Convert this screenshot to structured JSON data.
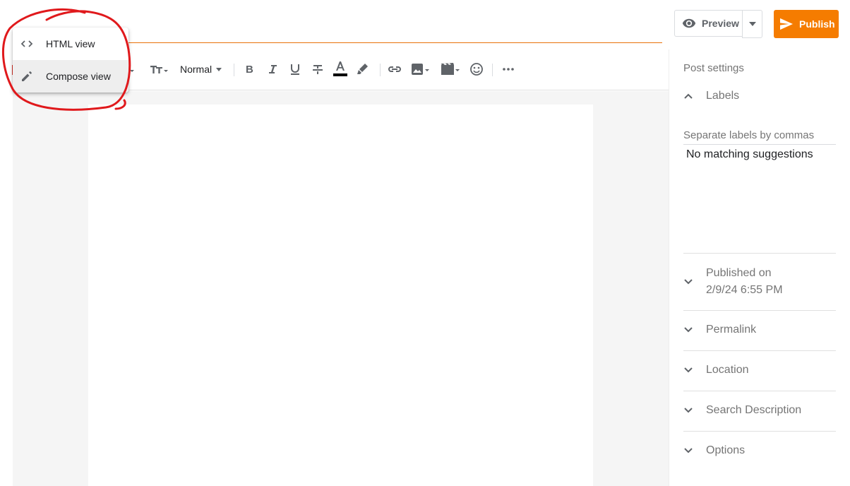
{
  "header": {
    "preview_label": "Preview",
    "publish_label": "Publish"
  },
  "toolbar": {
    "paragraph_style": "Normal",
    "text_color": "#000000"
  },
  "view_menu": {
    "items": [
      {
        "label": "HTML view",
        "icon": "code-icon"
      },
      {
        "label": "Compose view",
        "icon": "pencil-icon"
      }
    ]
  },
  "sidebar": {
    "title": "Post settings",
    "labels": {
      "heading": "Labels",
      "placeholder": "Separate labels by commas",
      "suggestions_text": "No matching suggestions"
    },
    "published": {
      "label": "Published on",
      "value": "2/9/24 6:55 PM"
    },
    "sections": [
      "Permalink",
      "Location",
      "Search Description",
      "Options"
    ]
  },
  "colors": {
    "accent": "#f57c00",
    "annotation": "#e0191c"
  }
}
